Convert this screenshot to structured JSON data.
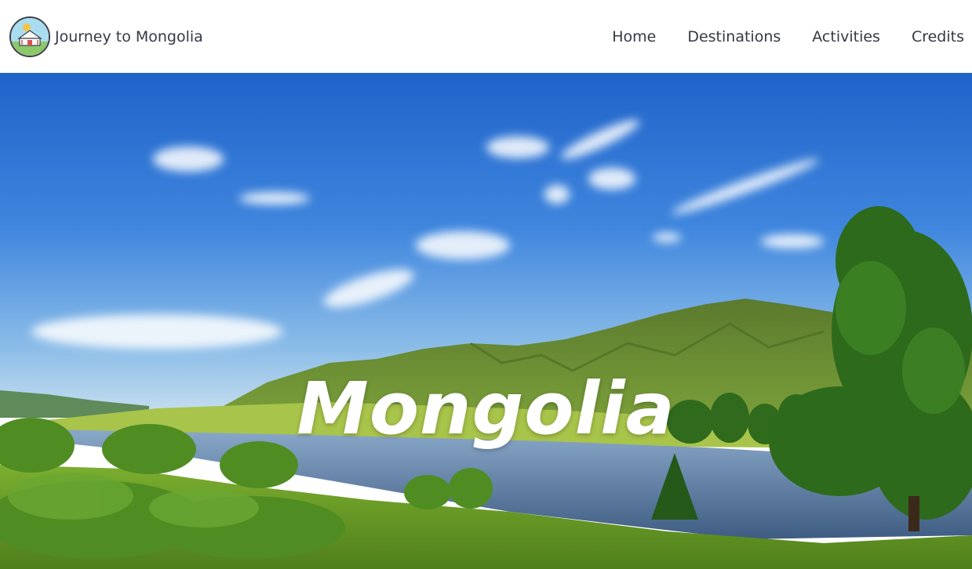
{
  "site": {
    "title": "Journey to Mongolia",
    "logo_icon": "yurt-icon"
  },
  "nav": {
    "items": [
      {
        "label": "Home"
      },
      {
        "label": "Destinations"
      },
      {
        "label": "Activities"
      },
      {
        "label": "Credits"
      }
    ]
  },
  "hero": {
    "title": "Mongolia",
    "image_subject": "photo"
  },
  "colors": {
    "text": "#333a45",
    "hero_text": "#ffffff"
  }
}
